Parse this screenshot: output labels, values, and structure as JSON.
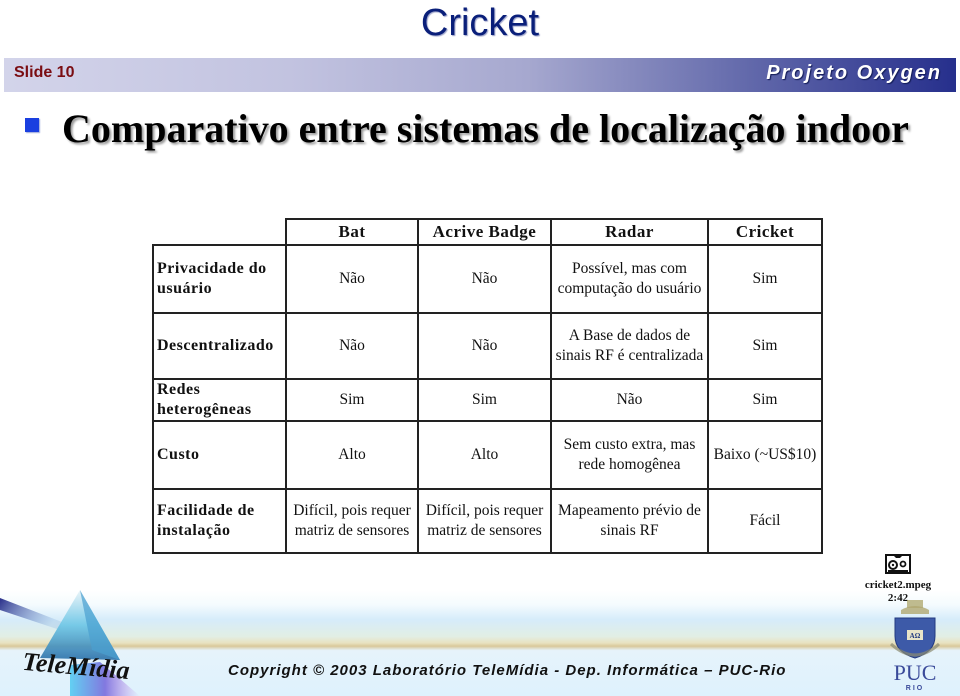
{
  "slide": {
    "top_title": "Cricket",
    "slide_number": "Slide 10",
    "project_name": "Projeto Oxygen",
    "heading": "Comparativo entre sistemas de localização indoor",
    "bullet_color": "#1a3fe0",
    "title_color": "#0a1f7a",
    "slide_number_color": "#7a0d12"
  },
  "table": {
    "columns": [
      "",
      "Bat",
      "Acrive Badge",
      "Radar",
      "Cricket"
    ],
    "rows": [
      {
        "label": "Privacidade do usuário",
        "cells": [
          "Não",
          "Não",
          "Possível, mas com computação do usuário",
          "Sim"
        ]
      },
      {
        "label": "Descentralizado",
        "cells": [
          "Não",
          "Não",
          "A Base de dados de sinais RF é centralizada",
          "Sim"
        ]
      },
      {
        "label": "Redes heterogêneas",
        "cells": [
          "Sim",
          "Sim",
          "Não",
          "Sim"
        ]
      },
      {
        "label": "Custo",
        "cells": [
          "Alto",
          "Alto",
          "Sem custo extra, mas rede homogênea",
          "Baixo (~US$10)"
        ]
      },
      {
        "label": "Facilidade de instalação",
        "cells": [
          "Difícil, pois requer matriz de sensores",
          "Difícil, pois requer matriz de sensores",
          "Mapeamento prévio de sinais RF",
          "Fácil"
        ]
      }
    ]
  },
  "media": {
    "icon": "video-file-icon",
    "filename": "cricket2.mpeg",
    "duration": "2:42"
  },
  "footer": {
    "copyright": "Copyright © 2003 Laboratório TeleMídia - Dep. Informática – PUC-Rio",
    "left_logo": "TeleMídia",
    "right_logo": "PUC RIO"
  }
}
